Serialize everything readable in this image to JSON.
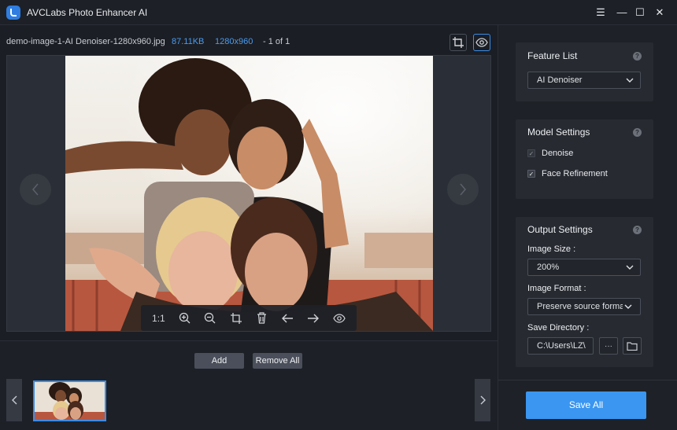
{
  "app": {
    "title": "AVCLabs Photo Enhancer AI"
  },
  "window_controls": {
    "menu": "☰",
    "minimize": "—",
    "maximize": "☐",
    "close": "✕"
  },
  "file_info": {
    "name": "demo-image-1-AI Denoiser-1280x960.jpg",
    "size": "87.11KB",
    "dimensions": "1280x960",
    "page": "- 1 of 1"
  },
  "toolbar": {
    "actual_size_label": "1:1"
  },
  "bottom": {
    "add_label": "Add",
    "remove_all_label": "Remove All"
  },
  "sidebar": {
    "feature_list": {
      "title": "Feature List",
      "selected": "AI Denoiser"
    },
    "model_settings": {
      "title": "Model Settings",
      "options": [
        {
          "label": "Denoise",
          "checked": true,
          "disabled": true
        },
        {
          "label": "Face Refinement",
          "checked": true,
          "disabled": false
        }
      ]
    },
    "output_settings": {
      "title": "Output Settings",
      "image_size_label": "Image Size :",
      "image_size_value": "200%",
      "image_format_label": "Image Format :",
      "image_format_value": "Preserve source format",
      "save_directory_label": "Save Directory :",
      "save_directory_value": "C:\\Users\\LZ\\",
      "browse_label": "···"
    },
    "save_all_label": "Save All"
  },
  "colors": {
    "accent": "#3a96f0",
    "link": "#4a9bf0",
    "background": "#1b1e24",
    "panel": "#272a31"
  },
  "icons": [
    "crop-icon",
    "eye-icon",
    "zoom-in-icon",
    "zoom-out-icon",
    "delete-icon",
    "arrow-left-icon",
    "arrow-right-icon",
    "folder-icon",
    "help-icon",
    "chevron-down-icon"
  ]
}
